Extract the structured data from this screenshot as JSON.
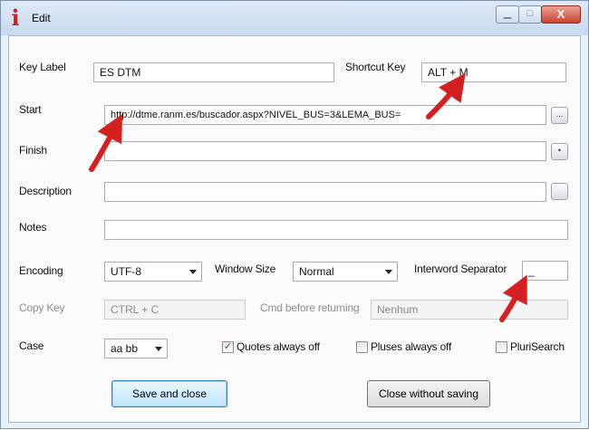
{
  "window": {
    "title": "Edit",
    "icon": "info-i-icon",
    "controls": {
      "minimize": "▁",
      "maximize": "□",
      "close": "X"
    }
  },
  "fields": {
    "key_label": {
      "label": "Key Label",
      "value": "ES DTM"
    },
    "shortcut_key": {
      "label": "Shortcut Key",
      "value": "ALT + M"
    },
    "start": {
      "label": "Start",
      "value": "http://dtme.ranm.es/buscador.aspx?NIVEL_BUS=3&LEMA_BUS=",
      "button": "..."
    },
    "finish": {
      "label": "Finish",
      "value": "",
      "button": "•"
    },
    "description": {
      "label": "Description",
      "value": ""
    },
    "notes": {
      "label": "Notes",
      "value": ""
    },
    "encoding": {
      "label": "Encoding",
      "value": "UTF-8"
    },
    "window_size": {
      "label": "Window Size",
      "value": "Normal"
    },
    "interword_separator": {
      "label": "Interword Separator",
      "value": "_"
    },
    "copy_key": {
      "label": "Copy Key",
      "value": "CTRL + C"
    },
    "cmd_before_returning": {
      "label": "Cmd before returning",
      "value": "Nenhum"
    },
    "case": {
      "label": "Case",
      "value": "aa bb"
    }
  },
  "checkboxes": {
    "quotes_always_off": {
      "label": "Quotes always off",
      "checked": true
    },
    "pluses_always_off": {
      "label": "Pluses always off",
      "checked": false
    },
    "plurisearch": {
      "label": "PluriSearch",
      "checked": false
    }
  },
  "buttons": {
    "save": "Save and close",
    "close_without_saving": "Close without saving"
  },
  "colors": {
    "annotation_arrow": "#d42020",
    "titlebar": "#c7d9ee",
    "close_button": "#c8452f"
  }
}
